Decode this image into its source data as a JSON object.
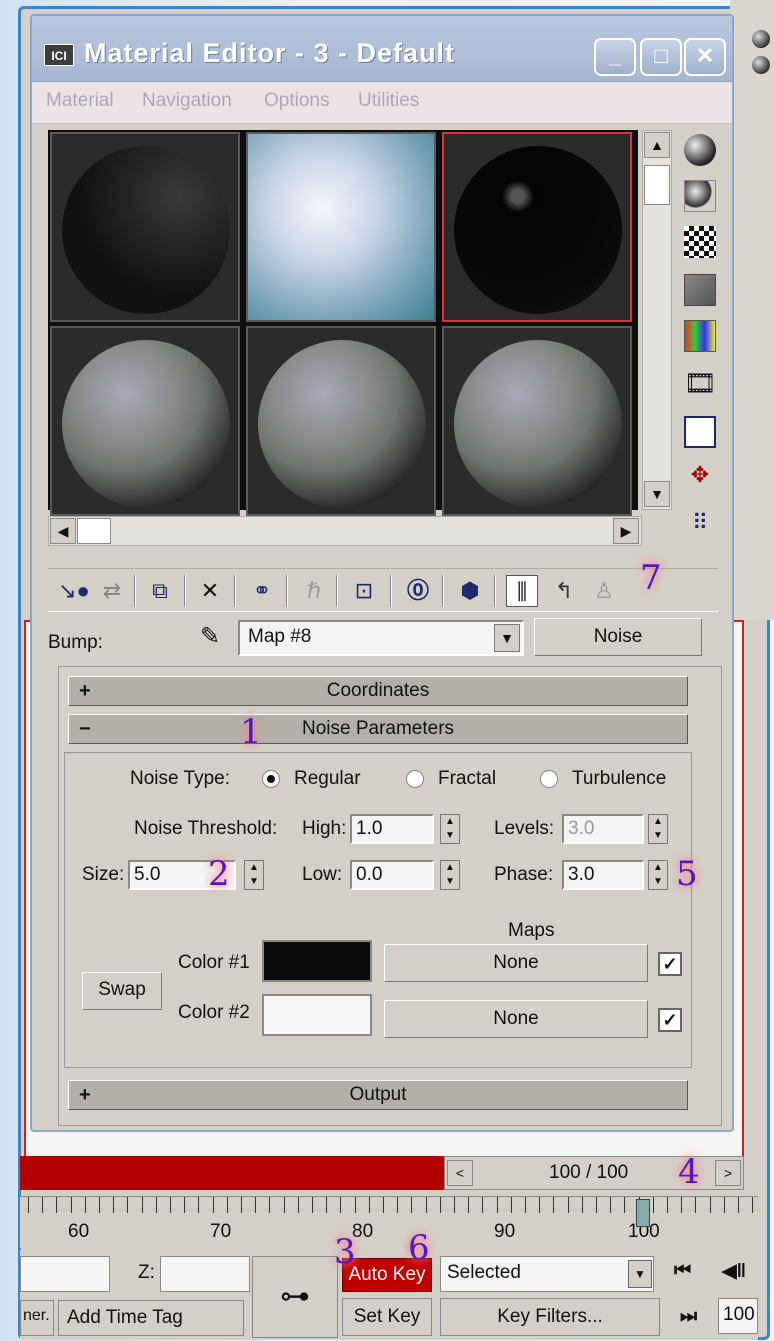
{
  "window": {
    "icon_text": "ICI",
    "title": "Material Editor - 3 - Default",
    "min_glyph": "_",
    "max_glyph": "□",
    "close_glyph": "✕"
  },
  "menu": [
    "Material",
    "Navigation",
    "Options",
    "Utilities"
  ],
  "bump": {
    "label": "Bump:",
    "map_value": "Map #8",
    "type_button": "Noise"
  },
  "rollouts": {
    "coordinates": {
      "sign": "+",
      "title": "Coordinates"
    },
    "noise_params": {
      "sign": "−",
      "title": "Noise Parameters"
    },
    "output": {
      "sign": "+",
      "title": "Output"
    }
  },
  "noise": {
    "type_label": "Noise Type:",
    "types": [
      {
        "label": "Regular",
        "selected": true
      },
      {
        "label": "Fractal",
        "selected": false
      },
      {
        "label": "Turbulence",
        "selected": false
      }
    ],
    "threshold_label": "Noise Threshold:",
    "high_label": "High:",
    "high_value": "1.0",
    "low_label": "Low:",
    "low_value": "0.0",
    "levels_label": "Levels:",
    "levels_value": "3.0",
    "size_label": "Size:",
    "size_value": "5.0",
    "phase_label": "Phase:",
    "phase_value": "3.0"
  },
  "colors": {
    "maps_header": "Maps",
    "swap_label": "Swap",
    "color1_label": "Color #1",
    "color1_hex": "#0b0b0b",
    "color1_map": "None",
    "color1_enabled": true,
    "color2_label": "Color #2",
    "color2_hex": "#f6f6f6",
    "color2_map": "None",
    "color2_enabled": true
  },
  "annotations": [
    "1",
    "2",
    "3",
    "4",
    "5",
    "6",
    "7"
  ],
  "timeline": {
    "frame_display": "100 / 100",
    "ticks": [
      "60",
      "70",
      "80",
      "90",
      "100"
    ]
  },
  "bottom": {
    "z_label": "Z:",
    "auto_key": "Auto Key",
    "set_key": "Set Key",
    "selected_option": "Selected",
    "key_filters": "Key Filters...",
    "add_time_tag": "Add Time Tag",
    "left_cut_text": "ner.",
    "frame_field": "100"
  },
  "accent_colors": {
    "active_slot": "#e0303a",
    "auto_key": "#c00000",
    "annotation": "#4a1ac8"
  }
}
